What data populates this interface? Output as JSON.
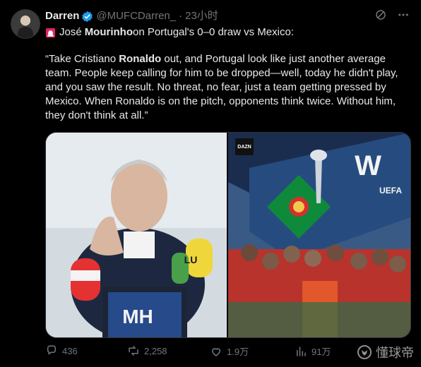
{
  "user": {
    "name": "Darren",
    "handle": "@MUFCDarren_",
    "separator": "·",
    "time": "23小时"
  },
  "headline": {
    "prefix": "José ",
    "bold": "Mourinho",
    "suffix": " on Portugal's 0–0 draw vs Mexico:"
  },
  "quote": {
    "part1": "“Take Cristiano ",
    "bold1": "Ronaldo",
    "part2": " out, and Portugal look like just another average team. People keep calling for him to be dropped—well, today he didn't play, and you saw the result. No threat, no fear, just a team getting pressed by Mexico. When Ronaldo is on the pitch, opponents think twice. Without him, they don't think at all.”"
  },
  "media": {
    "left_mic_label": "MH",
    "left_mic_brand": "LU",
    "right_badge": "DAZN",
    "right_sign": "W",
    "right_uefa": "UEFA"
  },
  "actions": {
    "replies": "436",
    "reposts": "2,258",
    "likes": "1.9万",
    "views": "91万"
  },
  "watermark": "懂球帝"
}
